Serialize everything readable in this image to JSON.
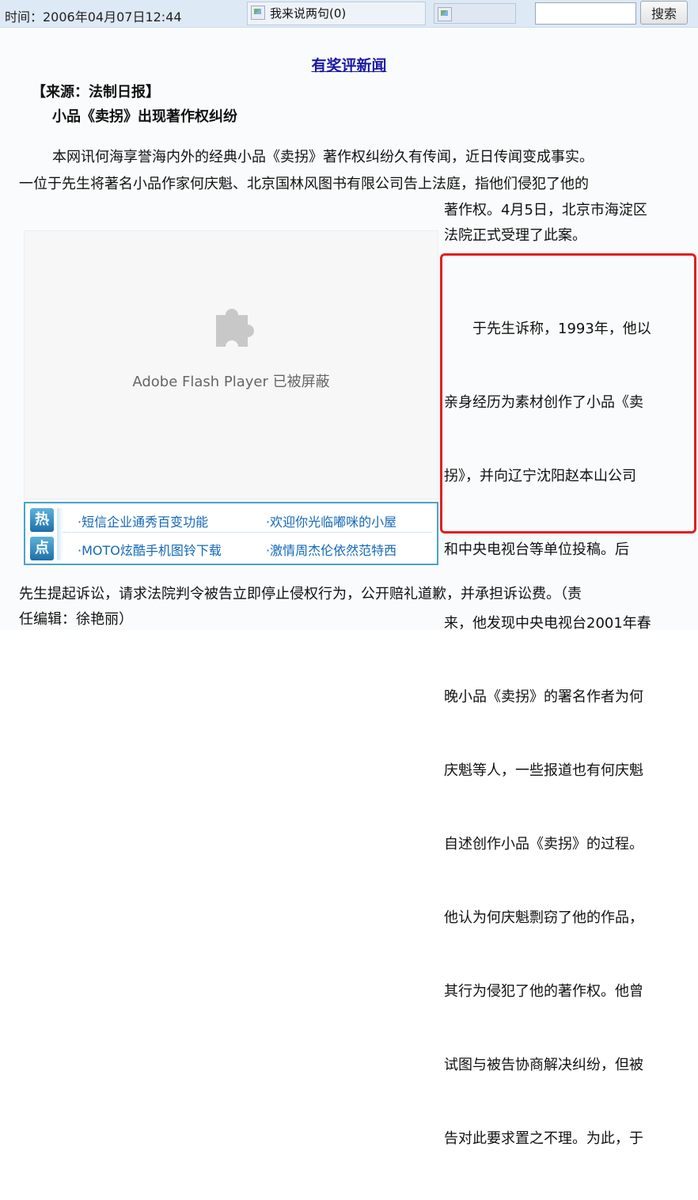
{
  "topbar": {
    "time_text": "时间：2006年04月07日12:44",
    "comment_link": "我来说两句(0)",
    "search_button": "搜索",
    "search_value": ""
  },
  "article": {
    "award_link": "有奖评新闻",
    "source": "【来源：法制日报】",
    "title": "小品《卖拐》出现著作权纠纷",
    "para1_line1": "本网讯何海享誉海内外的经典小品《卖拐》著作权纠纷久有传闻，近日传闻变成事实。",
    "para1_line2": "一位于先生将著名小品作家何庆魁、北京国林风图书有限公司告上法庭，指他们侵犯了他的",
    "col_lines": [
      "著作权。4月5日，北京市海淀区",
      "法院正式受理了此案。",
      "　　于先生诉称，1993年，他以",
      "亲身经历为素材创作了小品《卖",
      "拐》，并向辽宁沈阳赵本山公司",
      "和中央电视台等单位投稿。后",
      "来，他发现中央电视台2001年春",
      "晚小品《卖拐》的署名作者为何",
      "庆魁等人，一些报道也有何庆魁",
      "自述创作小品《卖拐》的过程。",
      "他认为何庆魁剽窃了他的作品，",
      "其行为侵犯了他的著作权。他曾",
      "试图与被告协商解决纠纷，但被",
      "告对此要求置之不理。为此，于"
    ],
    "tail_line1": "先生提起诉讼，请求法院判令被告立即停止侵权行为，公开赔礼道歉，并承担诉讼费。（责",
    "tail_line2": "任编辑：徐艳丽）"
  },
  "flash": {
    "message": "Adobe Flash Player 已被屏蔽",
    "icon": "puzzle-piece-icon"
  },
  "ad_box": {
    "badge_hot": "热",
    "badge_point": "点",
    "links": [
      "·短信企业通秀百变功能",
      "·欢迎你光临嘟咪的小屋",
      "·MOTO炫酷手机图铃下载",
      "·激情周杰伦依然范特西"
    ]
  },
  "colors": {
    "highlight": "#e02020",
    "link": "#1a1aa6",
    "topbar": "#dde9f5"
  }
}
